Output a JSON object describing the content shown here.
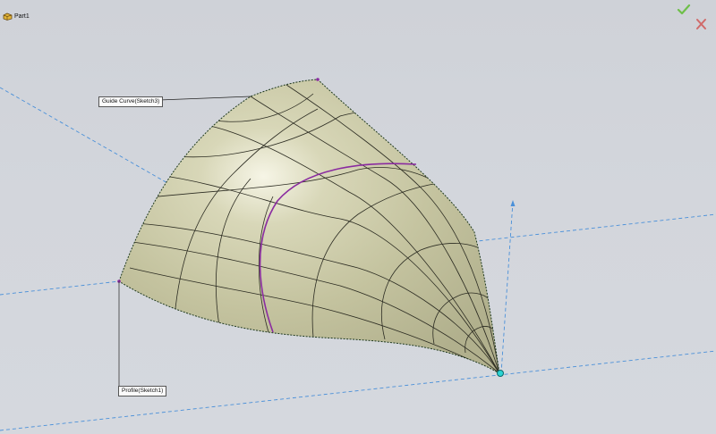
{
  "window": {
    "part_name": "Part1"
  },
  "icons": {
    "part": "part-icon",
    "confirm": "check-icon",
    "cancel": "close-icon"
  },
  "callouts": {
    "guide_curve": "Guide Curve(Sketch3)",
    "profile": "Profile(Sketch1)"
  },
  "colors": {
    "background": "#d3d6dc",
    "surface": "#c9c8a6",
    "axis": "#4a90d9",
    "guide_curve": "#8a2ba0",
    "confirm": "#6fbf4a",
    "cancel": "#d06a6a"
  }
}
